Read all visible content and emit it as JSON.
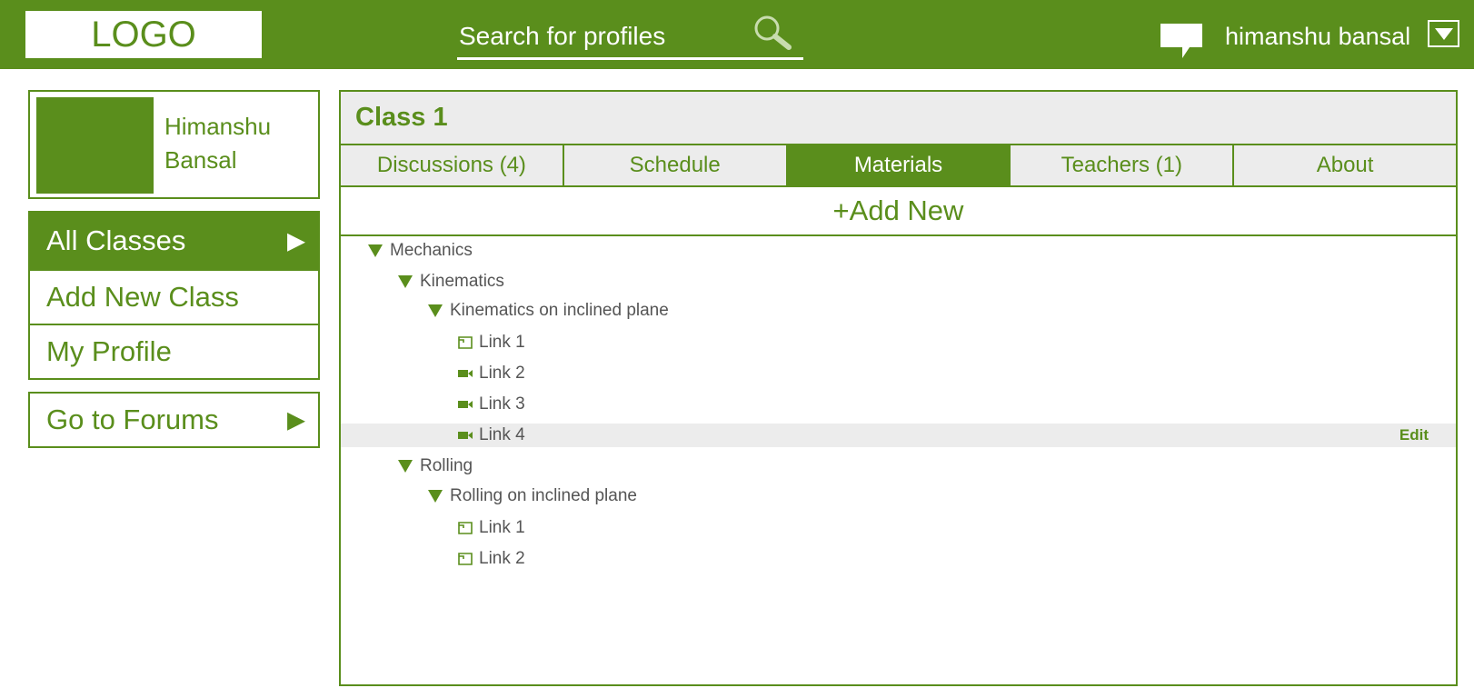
{
  "header": {
    "logo": "LOGO",
    "search_placeholder": "Search for profiles",
    "user_name": "himanshu bansal"
  },
  "sidebar": {
    "profile_name_first": "Himanshu",
    "profile_name_last": "Bansal",
    "nav": [
      {
        "label": "All Classes",
        "active": true
      },
      {
        "label": "Add New Class",
        "active": false
      },
      {
        "label": "My Profile",
        "active": false
      }
    ],
    "forums_label": "Go to Forums",
    "arrow": "▶"
  },
  "main": {
    "class_title": "Class 1",
    "tabs": [
      {
        "label": "Discussions (4)",
        "active": false
      },
      {
        "label": "Schedule",
        "active": false
      },
      {
        "label": "Materials",
        "active": true
      },
      {
        "label": "Teachers (1)",
        "active": false
      },
      {
        "label": "About",
        "active": false
      }
    ],
    "add_new_label": "+Add New",
    "edit_label": "Edit",
    "tree": [
      {
        "label": "Mechanics",
        "level": 0,
        "type": "folder"
      },
      {
        "label": "Kinematics",
        "level": 1,
        "type": "folder"
      },
      {
        "label": "Kinematics on inclined plane",
        "level": 2,
        "type": "folder"
      },
      {
        "label": "Link 1",
        "level": 3,
        "type": "document"
      },
      {
        "label": "Link 2",
        "level": 3,
        "type": "video"
      },
      {
        "label": "Link 3",
        "level": 3,
        "type": "video"
      },
      {
        "label": "Link 4",
        "level": 3,
        "type": "video",
        "highlighted": true
      },
      {
        "label": "Rolling",
        "level": 1,
        "type": "folder"
      },
      {
        "label": "Rolling on inclined plane",
        "level": 2,
        "type": "folder"
      },
      {
        "label": "Link 1",
        "level": 3,
        "type": "document"
      },
      {
        "label": "Link 2",
        "level": 3,
        "type": "document"
      }
    ]
  },
  "colors": {
    "accent": "#5a8e1c",
    "panel_bg": "#ececec",
    "text": "#555555"
  }
}
